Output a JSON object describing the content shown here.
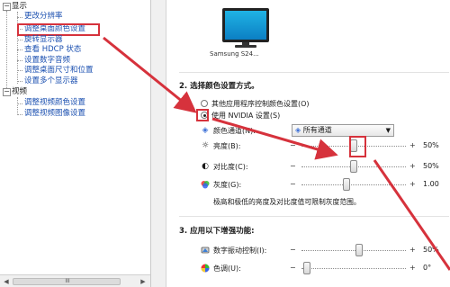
{
  "tree": {
    "display_label": "显示",
    "display_items": [
      "更改分辨率",
      "调整桌面颜色设置",
      "旋转显示器",
      "查看 HDCP 状态",
      "设置数字音频",
      "调整桌面尺寸和位置",
      "设置多个显示器"
    ],
    "video_label": "视频",
    "video_items": [
      "调整视频颜色设置",
      "调整视频图像设置"
    ],
    "expand_symbol": "−"
  },
  "monitor": {
    "label": "Samsung S24..."
  },
  "section2": {
    "title": "2.  选择颜色设置方式。",
    "option1": "其他应用程序控制颜色设置(O)",
    "option2": "使用 NVIDIA 设置(S)",
    "channel_label": "颜色通道(N):",
    "channel_value": "所有通道",
    "brightness_label": "亮度(B):",
    "brightness_value": "50%",
    "brightness_level": 50,
    "contrast_label": "对比度(C):",
    "contrast_value": "50%",
    "contrast_level": 50,
    "gamma_label": "灰度(G):",
    "gamma_value": "1.00",
    "note": "极高和极低的亮度及对比度值可限制灰度范围。"
  },
  "section3": {
    "title": "3.  应用以下增强功能:",
    "vibrance_label": "数字振动控制(I):",
    "vibrance_value": "50%",
    "hue_label": "色调(U):",
    "hue_value": "0°"
  },
  "scrollbar": {
    "left_arrow": "◀",
    "right_arrow": "▶",
    "grip": "III"
  },
  "colors": {
    "highlight": "#d6323c",
    "link": "#1a4fb0"
  }
}
